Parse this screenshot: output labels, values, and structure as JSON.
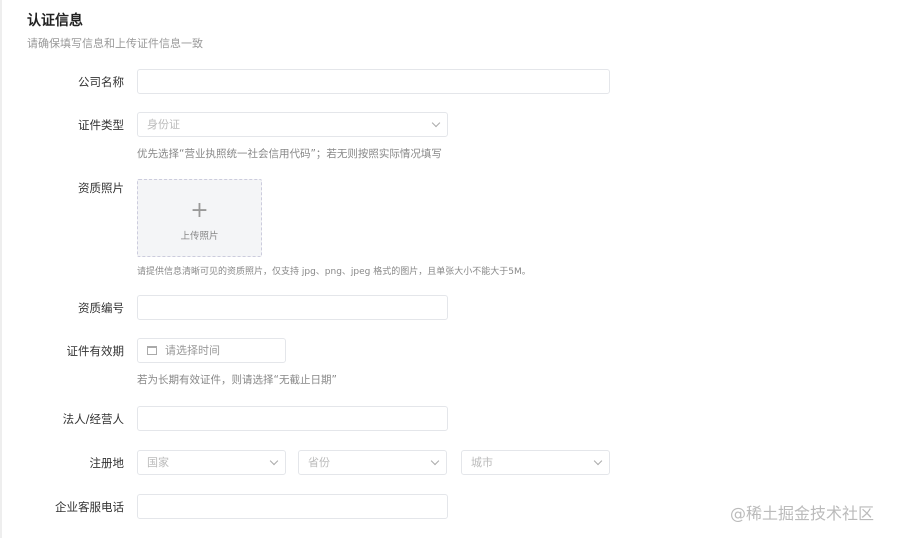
{
  "header": {
    "title": "认证信息",
    "subtitle": "请确保填写信息和上传证件信息一致"
  },
  "fields": {
    "company_name": {
      "label": "公司名称"
    },
    "cert_type": {
      "label": "证件类型",
      "value": "身份证",
      "hint": "优先选择“营业执照统一社会信用代码”；若无则按照实际情况填写"
    },
    "photo": {
      "label": "资质照片",
      "upload_label": "上传照片",
      "hint": "请提供信息清晰可见的资质照片，仅支持 jpg、png、jpeg 格式的图片，且单张大小不能大于5M。"
    },
    "qual_no": {
      "label": "资质编号"
    },
    "validity": {
      "label": "证件有效期",
      "placeholder": "请选择时间",
      "hint": "若为长期有效证件，则请选择“无截止日期”"
    },
    "legal": {
      "label": "法人/经营人"
    },
    "region": {
      "label": "注册地",
      "country": "国家",
      "province": "省份",
      "city": "城市"
    },
    "phone": {
      "label": "企业客服电话"
    }
  },
  "watermark": "@稀土掘金技术社区"
}
